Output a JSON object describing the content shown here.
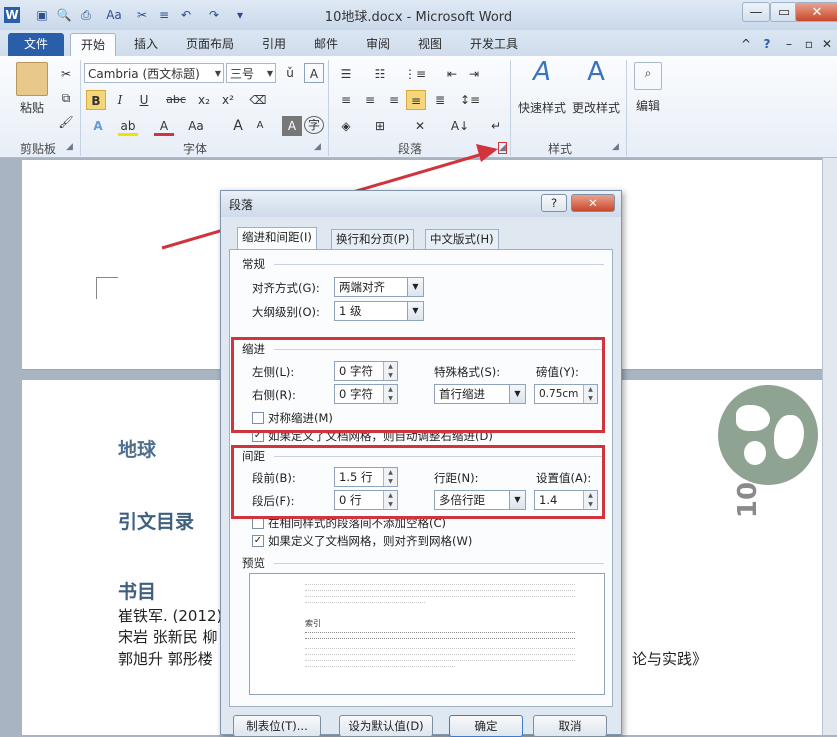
{
  "window": {
    "title": "10地球.docx - Microsoft Word",
    "app_icon": "W"
  },
  "quick_access": [
    "save-icon",
    "print-preview-icon",
    "print-icon",
    "font-size-icon",
    "format-painter-icon",
    "undo-icon",
    "redo-icon",
    "customize-icon"
  ],
  "tabs": [
    {
      "label": "文件"
    },
    {
      "label": "开始"
    },
    {
      "label": "插入"
    },
    {
      "label": "页面布局"
    },
    {
      "label": "引用"
    },
    {
      "label": "邮件"
    },
    {
      "label": "审阅"
    },
    {
      "label": "视图"
    },
    {
      "label": "开发工具"
    }
  ],
  "ribbon": {
    "clipboard": {
      "paste_label": "粘贴",
      "group_label": "剪贴板"
    },
    "font": {
      "font_name": "Cambria (西文标题)",
      "font_size": "三号",
      "group_label": "字体",
      "bold": "B",
      "italic": "I",
      "underline": "U",
      "strike": "abc",
      "subscript": "x₂",
      "superscript": "x²",
      "grow": "A",
      "shrink": "A",
      "case": "Aa"
    },
    "paragraph": {
      "group_label": "段落"
    },
    "styles": {
      "quick_styles": "快速样式",
      "change_styles": "更改样式",
      "group_label": "样式"
    },
    "editing": {
      "label": "编辑"
    }
  },
  "document": {
    "heading1": "地球",
    "heading2": "引文目录",
    "heading3": "书目",
    "line1": "崔铁军. (2012).",
    "line2": "宋岩 张新民 柳",
    "line3": "郭旭升 郭彤楼",
    "line3_tail": "论与实践》",
    "chapter_number": "10"
  },
  "dialog": {
    "title": "段落",
    "help": "?",
    "close": "✕",
    "tabs": [
      "缩进和间距(I)",
      "换行和分页(P)",
      "中文版式(H)"
    ],
    "general": {
      "section": "常规",
      "align_label": "对齐方式(G):",
      "align_value": "两端对齐",
      "outline_label": "大纲级别(O):",
      "outline_value": "1 级"
    },
    "indent": {
      "section": "缩进",
      "left_label": "左侧(L):",
      "left_value": "0 字符",
      "right_label": "右侧(R):",
      "right_value": "0 字符",
      "special_label": "特殊格式(S):",
      "special_value": "首行缩进",
      "by_label": "磅值(Y):",
      "by_value": "0.75cm",
      "mirror_label": "对称缩进(M)",
      "auto_adjust_label": "如果定义了文档网格，则自动调整右缩进(D)"
    },
    "spacing": {
      "section": "间距",
      "before_label": "段前(B):",
      "before_value": "1.5 行",
      "after_label": "段后(F):",
      "after_value": "0 行",
      "line_label": "行距(N):",
      "line_value": "多倍行距",
      "at_label": "设置值(A):",
      "at_value": "1.4",
      "no_space_label": "在相同样式的段落间不添加空格(C)",
      "snap_grid_label": "如果定义了文档网格，则对齐到网格(W)"
    },
    "preview": {
      "section": "预览",
      "sample_text": "索引"
    },
    "buttons": {
      "tabs": "制表位(T)...",
      "default": "设为默认值(D)",
      "ok": "确定",
      "cancel": "取消"
    },
    "checkboxes": {
      "mirror": false,
      "auto_adjust": true,
      "no_space": false,
      "snap_grid": true
    }
  },
  "colors": {
    "file_tab": "#2a5ea9",
    "highlight_box": "#d0343d",
    "heading_text": "#4f6f8f"
  }
}
